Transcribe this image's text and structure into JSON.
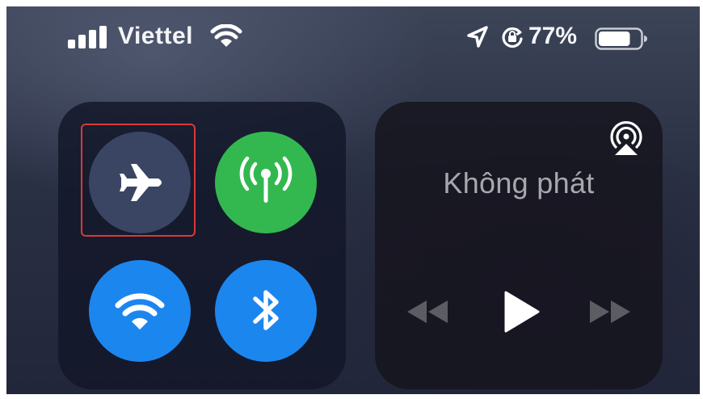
{
  "status_bar": {
    "carrier": "Viettel",
    "battery_percent": "77%",
    "battery_level": 0.77,
    "icons": [
      "cellular-signal-icon",
      "wifi-icon",
      "location-arrow-icon",
      "orientation-lock-icon",
      "battery-icon"
    ]
  },
  "connectivity": {
    "airplane": {
      "icon": "airplane-icon",
      "state": "off",
      "highlighted": true
    },
    "cellular": {
      "icon": "cellular-data-icon",
      "state": "on",
      "color": "#33b84f"
    },
    "wifi": {
      "icon": "wifi-icon",
      "state": "on",
      "color": "#1c86ef"
    },
    "bluetooth": {
      "icon": "bluetooth-icon",
      "state": "on",
      "color": "#1c86ef"
    },
    "highlight_color": "#d63a3a"
  },
  "media": {
    "now_playing": "Không phát",
    "controls": [
      "rewind-icon",
      "play-icon",
      "fast-forward-icon"
    ],
    "airplay_icon": "airplay-audio-icon"
  }
}
